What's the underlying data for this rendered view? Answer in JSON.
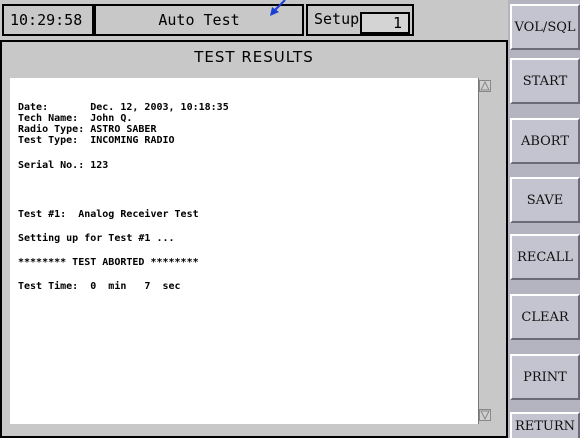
{
  "header": {
    "clock": "10:29:58",
    "mode": "Auto Test",
    "setup_label": "Setup",
    "setup_value": "1"
  },
  "results": {
    "title": "TEST RESULTS",
    "lines": [
      "Date:       Dec. 12, 2003, 10:18:35",
      "Tech Name:  John Q.",
      "Radio Type: ASTRO SABER",
      "Test Type:  INCOMING RADIO",
      "Serial No.: 123",
      "Test #1:  Analog Receiver Test",
      "Setting up for Test #1 ...",
      "******** TEST ABORTED ********",
      "Test Time:  0  min   7  sec"
    ]
  },
  "sidebar": {
    "buttons": [
      "VOL/SQL",
      "START",
      "ABORT",
      "SAVE",
      "RECALL",
      "CLEAR",
      "PRINT",
      "RETURN"
    ]
  },
  "colors": {
    "panel_bg": "#c8c8c8",
    "button_bg": "#c4c4d0",
    "pointer_arrow": "#1a3fd6"
  },
  "icons": {
    "pointer": "arrow-pointer-icon",
    "scroll_up": "scroll-up-icon",
    "scroll_down": "scroll-down-icon"
  }
}
